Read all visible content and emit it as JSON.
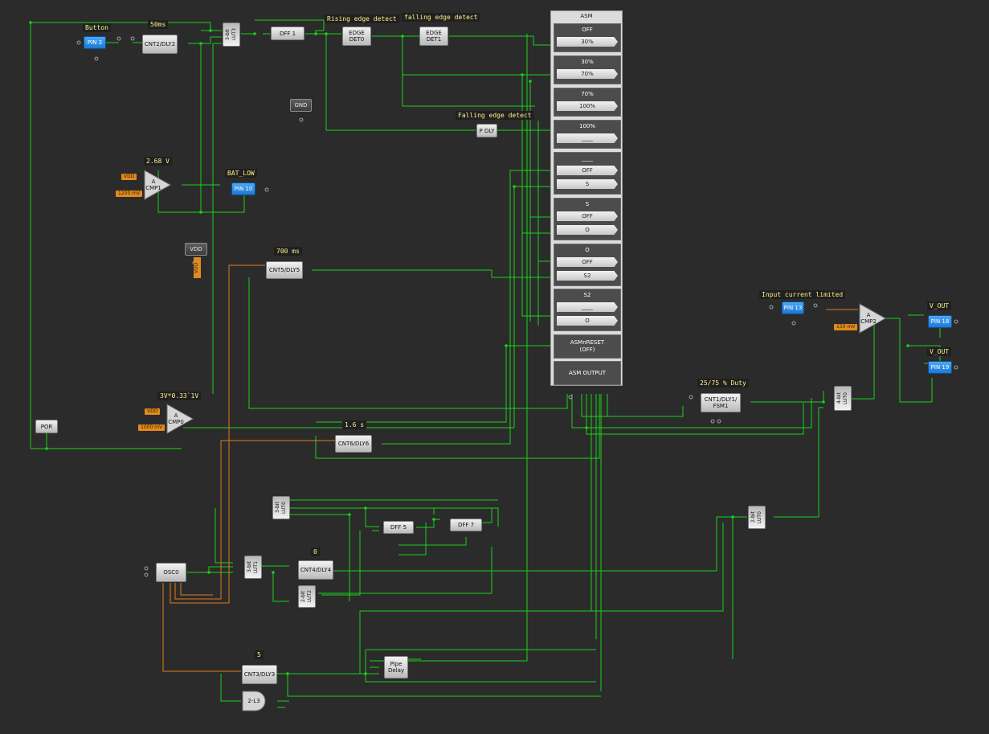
{
  "labels": {
    "button": "Button",
    "t50ms": "50ms",
    "rising": "Rising edge detect",
    "falling1": "falling edge detect",
    "falling2": "Falling edge detect",
    "v268": "2.68 V",
    "batlow": "BAT_LOW",
    "t700": "700 ms",
    "cmp0": "3V*0.33`1V",
    "t16": "1.6 s",
    "duty": "25/75 % Duty",
    "icl": "Input current limited",
    "vout1": "V_OUT",
    "vout2": "V_OUT",
    "zero": "0",
    "five": "5"
  },
  "blocks": {
    "pin3": "PIN 3",
    "cnt2": "CNT2/DLY2",
    "lut3": "3-bit\nLUT3",
    "dff1": "DFF 1",
    "edge0": "EDGE\nDET0",
    "edge1": "EDGE\nDET1",
    "gnd": "GND",
    "pdly": "P DLY",
    "cmp1": "A\nCMP1",
    "pin10": "PIN 10",
    "vdd": "VDD",
    "cnt5": "CNT5/DLY5",
    "por": "POR",
    "cmp0": "A\nCMP0",
    "cnt6": "CNT6/DLY6",
    "lut0": "3-bit\nLUT0",
    "dff5": "DFF 5",
    "dff7": "DFF 7",
    "osc0": "OSC0",
    "lut1": "3-bit\nLUT1",
    "cnt4": "CNT4/DLY4",
    "lut2": "2-bit\nLUT2",
    "cnt3": "CNT3/DLY3",
    "pipe": "Pipe\nDelay",
    "and3": "2-L3",
    "cnt1": "CNT1/DLY1/\nFSM1",
    "lut4": "4-bit\nLUT0",
    "lut2b": "2-bit\nLUT0",
    "pin13": "PIN 13",
    "cmp2": "A\nCMP2",
    "pin18": "PIN 18",
    "pin19": "PIN 19"
  },
  "tags": {
    "vdd1": "VDD",
    "mv1200": "1200 mV",
    "vdd2": "VDD",
    "mv1000": "1000 mV",
    "vddv": "VDD",
    "mv150": "150 mV"
  },
  "asm": {
    "title": "ASM",
    "states": [
      {
        "name": "OFF",
        "transitions": [
          "30%"
        ]
      },
      {
        "name": "30%",
        "transitions": [
          "70%"
        ]
      },
      {
        "name": "70%",
        "transitions": [
          "100%"
        ]
      },
      {
        "name": "100%",
        "transitions": [
          "____"
        ]
      },
      {
        "name": "____",
        "transitions": [
          "OFF",
          "S"
        ]
      },
      {
        "name": "S",
        "transitions": [
          "OFF",
          "O"
        ]
      },
      {
        "name": "O",
        "transitions": [
          "OFF",
          "S2"
        ]
      },
      {
        "name": "S2",
        "transitions": [
          "____",
          "O"
        ]
      }
    ],
    "reset": "ASMnRESET\n(OFF)",
    "output": "ASM OUTPUT"
  },
  "colors": {
    "wire": "#19d119",
    "clock_wire": "#e07b1a",
    "background": "#2b2b2b"
  }
}
